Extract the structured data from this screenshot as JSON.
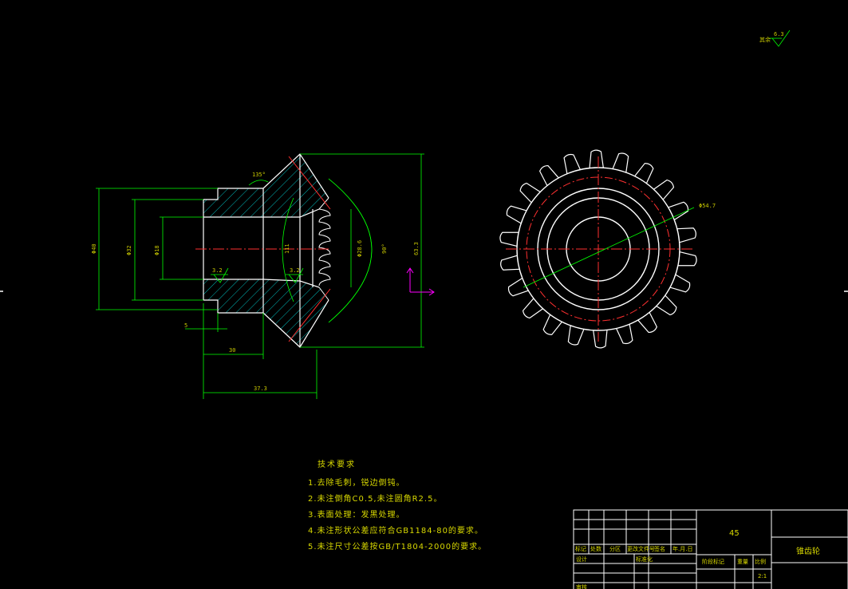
{
  "drawing": {
    "dimensions": {
      "d_outer": "Φ40",
      "d_mid": "Φ32",
      "d_bore": "Φ18",
      "length_5": "5",
      "length_30": "30",
      "length_37": "37.3",
      "height_63": "63.3",
      "d_285": "Φ28.6",
      "angle_90": "90°",
      "angle_135": "135°",
      "rough_left": "3.2",
      "rough_right": "3.2",
      "inner_label": "111",
      "gear_od": "Φ54.7",
      "surface_rest": "其余",
      "surface_val": "6.3"
    },
    "notes": {
      "title": "技术要求",
      "lines": [
        "1.去除毛刺，锐边倒钝。",
        "2.未注倒角C0.5,未注圆角R2.5。",
        "3.表面处理：发黑处理。",
        "4.未注形状公差应符合GB1184-80的要求。",
        "5.未注尺寸公差按GB/T1804-2000的要求。"
      ]
    },
    "title_block": {
      "material": "45",
      "part_name": "锥齿轮",
      "scale_label": "比例",
      "scale_value": "2:1",
      "stage_label": "阶段标记",
      "weight_label": "重量",
      "mark_label": "标记",
      "count_label": "处数",
      "zone_label": "分区",
      "change_doc_label": "更改文件号",
      "sign_label": "签名",
      "date_label": "年.月.日",
      "design_label": "设计",
      "std_label": "标准化",
      "review_label": "审核"
    },
    "colors": {
      "outline": "#ffffff",
      "dimension": "#00ff00",
      "center": "#ff0000",
      "hatch": "#00e5e5",
      "axis": "#ff00ff",
      "text": "#d8d800"
    }
  }
}
